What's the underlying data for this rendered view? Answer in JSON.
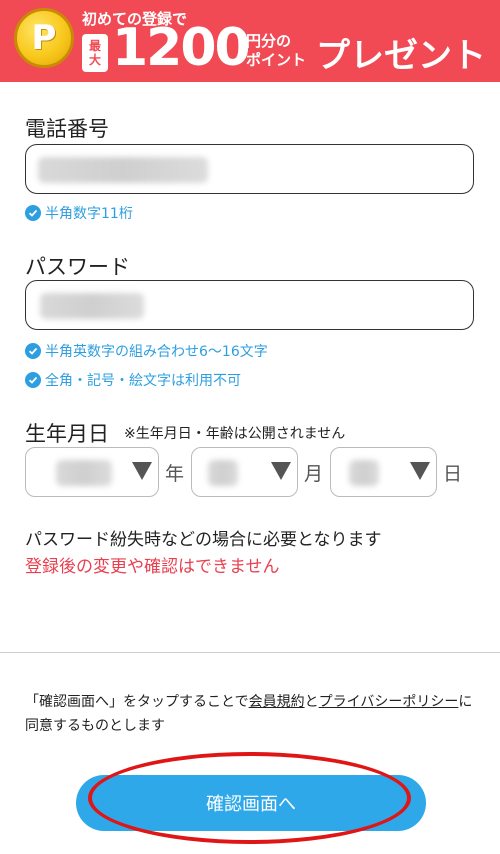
{
  "banner": {
    "coin_letter": "P",
    "line1": "初めての登録で",
    "badge_top": "最",
    "badge_bottom": "大",
    "amount": "1200",
    "unit_line1": "円分の",
    "unit_line2": "ポイント",
    "present": "プレゼント"
  },
  "form": {
    "phone": {
      "label": "電話番号",
      "hint": "半角数字11桁"
    },
    "password": {
      "label": "パスワード",
      "hints": [
        "半角英数字の組み合わせ6〜16文字",
        "全角・記号・絵文字は利用不可"
      ]
    },
    "birthday": {
      "label": "生年月日",
      "note": "※生年月日・年齢は公開されません",
      "year_unit": "年",
      "month_unit": "月",
      "day_unit": "日"
    },
    "notice_line1": "パスワード紛失時などの場合に必要となります",
    "notice_line2": "登録後の変更や確認はできません"
  },
  "terms": {
    "prefix": "「確認画面へ」をタップすることで",
    "link1": "会員規約",
    "conjunction": "と",
    "link2": "プライバシーポリシー",
    "suffix": "に同意するものとします"
  },
  "button": {
    "confirm_label": "確認画面へ"
  },
  "colors": {
    "banner_red": "#f24a54",
    "accent_blue": "#2d9fe0",
    "button_blue": "#2fa8ea",
    "warning_red": "#e8404f",
    "annotation_red": "#e01515"
  },
  "icons": {
    "check": "check-circle-icon",
    "dropdown": "triangle-down-icon",
    "coin": "point-coin-icon"
  }
}
